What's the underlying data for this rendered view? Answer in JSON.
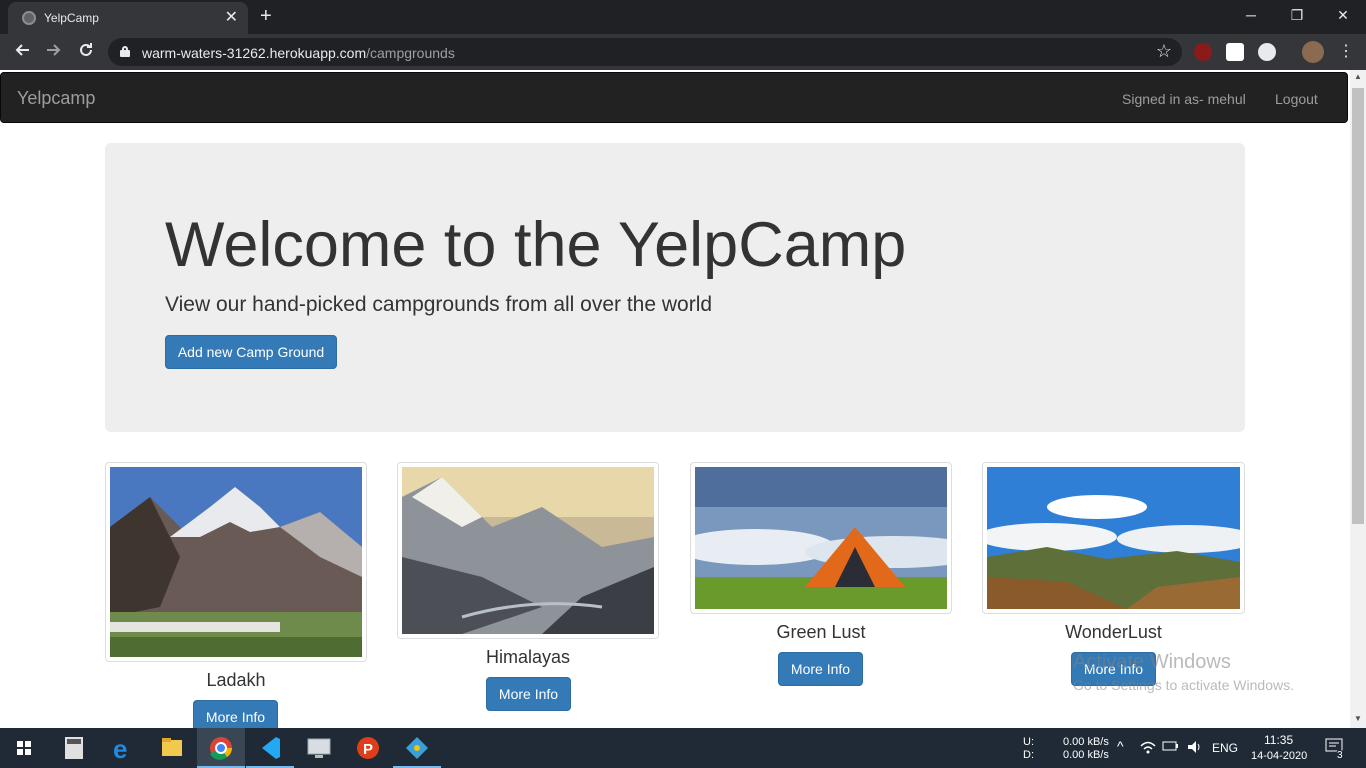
{
  "browser": {
    "tab_title": "YelpCamp",
    "tab_close": "✕",
    "new_tab": "+",
    "url_host": "warm-waters-31262.herokuapp.com",
    "url_path": "/campgrounds",
    "min": "─",
    "restore": "❐",
    "close": "✕"
  },
  "navbar": {
    "brand": "Yelpcamp",
    "signed_in": "Signed in as- mehul",
    "logout": "Logout"
  },
  "jumbotron": {
    "title": "Welcome to the YelpCamp",
    "subtitle": "View our hand-picked campgrounds from all over the world",
    "add_button": "Add new Camp Ground"
  },
  "campgrounds": [
    {
      "name": "Ladakh",
      "button": "More Info"
    },
    {
      "name": "Himalayas",
      "button": "More Info"
    },
    {
      "name": "Green Lust",
      "button": "More Info"
    },
    {
      "name": "WonderLust",
      "button": "More Info"
    }
  ],
  "watermark": {
    "line1": "Activate Windows",
    "line2": "Go to Settings to activate Windows."
  },
  "taskbar": {
    "net_up_label": "U:",
    "net_down_label": "D:",
    "net_up": "0.00 kB/s",
    "net_down": "0.00 kB/s",
    "lang": "ENG",
    "time": "11:35",
    "date": "14-04-2020",
    "notifications": "3"
  }
}
